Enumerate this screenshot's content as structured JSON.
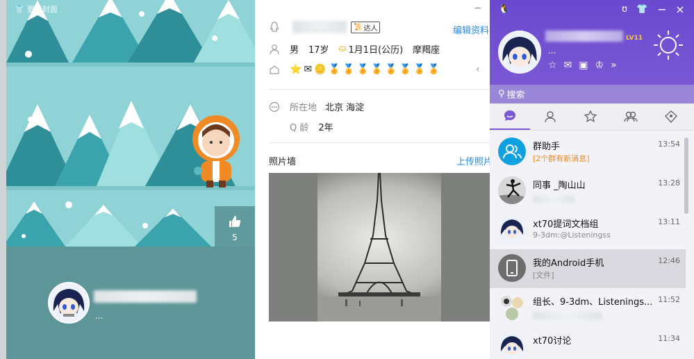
{
  "profile": {
    "change_cover_label": "更换封面",
    "like_count": "5",
    "name_dots": "...",
    "talent_badge": "达人",
    "edit_profile": "编辑资料",
    "gender": "男",
    "age": "17岁",
    "birthday": "1月1日(公历)",
    "zodiac": "摩羯座",
    "location_label": "所在地",
    "location_value": "北京 海淀",
    "qage_label": "Q 龄",
    "qage_value": "2年",
    "photo_wall_label": "照片墙",
    "upload_photo": "上传照片"
  },
  "qq": {
    "level": "LV11",
    "name_dots": "...",
    "search_placeholder": "搜索",
    "chats": [
      {
        "name": "群助手",
        "sub": "[2个群有新消息]",
        "time": "13:54"
      },
      {
        "name": "同事 _陶山山",
        "sub": "",
        "time": "13:28"
      },
      {
        "name": "xt70提词文档组",
        "sub": "9-3dm:@Listeningss",
        "time": "13:11"
      },
      {
        "name": "我的Android手机",
        "sub": "[文件]",
        "time": "12:46"
      },
      {
        "name": "组长、9-3dm、Listenings...",
        "sub": "",
        "time": "11:52"
      },
      {
        "name": "xt70讨论",
        "sub": "",
        "time": "11:34"
      }
    ]
  },
  "colors": {
    "qq_purple": "#6a49cf",
    "link_blue": "#2a8ae6",
    "notice_orange": "#f08a24",
    "cover_teal": "#8fd3d6"
  }
}
